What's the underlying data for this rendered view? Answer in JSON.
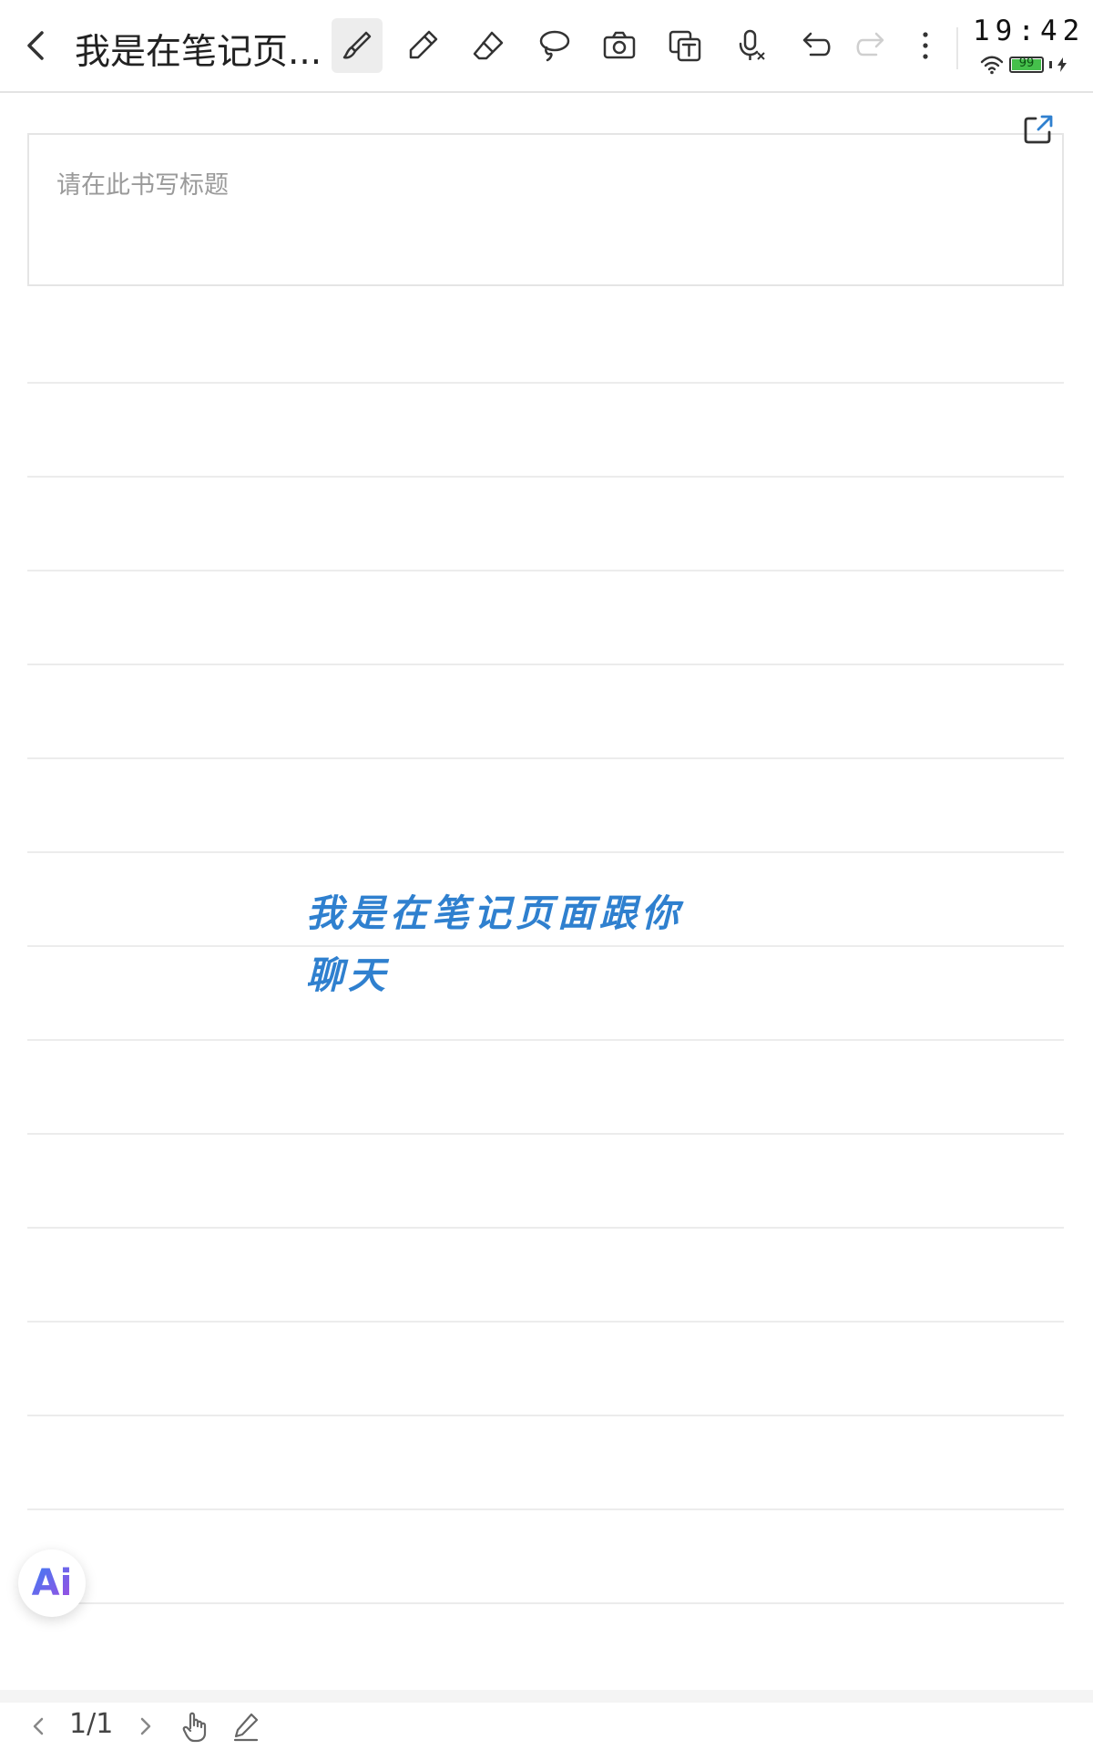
{
  "toolbar": {
    "note_title": "我是在笔记页...",
    "back_icon": "chevron-left-icon",
    "tools": [
      "brush-pen-icon",
      "pencil-icon",
      "eraser-icon",
      "lasso-icon",
      "camera-icon",
      "text-recognize-icon",
      "voice-to-text-icon",
      "undo-icon",
      "redo-icon",
      "more-icon"
    ],
    "active_tool": "brush-pen-icon"
  },
  "status": {
    "time": "19:42",
    "battery": "99",
    "battery_level": 0.99,
    "battery_color": "#45c04b",
    "charging": true
  },
  "note": {
    "title_placeholder": "请在此书写标题",
    "export_icon": "export-icon",
    "handwriting": [
      "我是在笔记页面跟你",
      "聊天"
    ],
    "ink_color": "#2f80cf"
  },
  "ai_button": {
    "label": "Ai"
  },
  "bottom": {
    "page_indicator": "1/1",
    "icons": [
      "chevron-left-icon",
      "chevron-right-icon",
      "hand-icon",
      "pen-icon"
    ]
  }
}
